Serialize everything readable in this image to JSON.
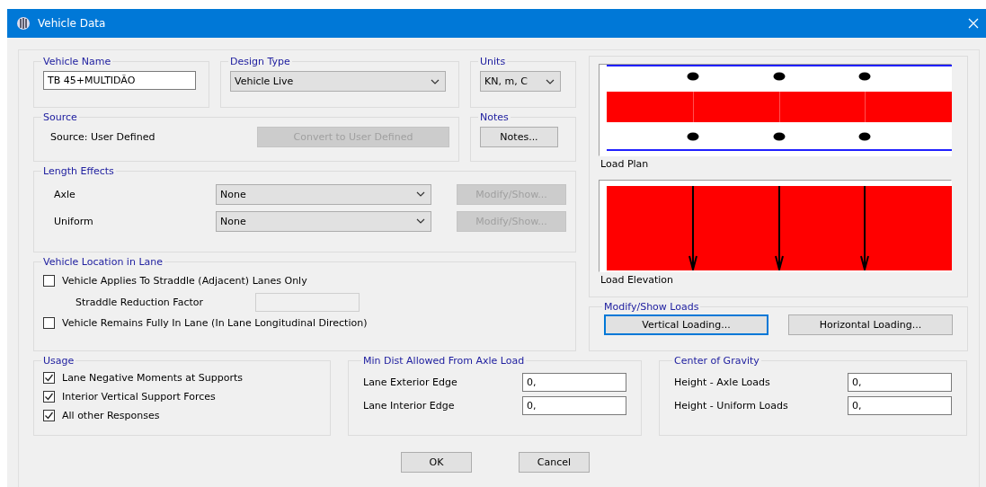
{
  "window": {
    "title": "Vehicle Data"
  },
  "vehicle_name": {
    "label": "Vehicle Name",
    "value": "TB 45+MULTIDÃO"
  },
  "design_type": {
    "label": "Design Type",
    "value": "Vehicle Live"
  },
  "units": {
    "label": "Units",
    "value": "KN, m, C"
  },
  "source": {
    "label": "Source",
    "text": "Source: User Defined",
    "button": {
      "label": "Convert to User Defined",
      "disabled": true
    }
  },
  "notes": {
    "label": "Notes",
    "button": {
      "label": "Notes...",
      "disabled": false
    }
  },
  "length_effects": {
    "label": "Length Effects",
    "rows": [
      {
        "label": "Axle",
        "value": "None",
        "button": {
          "label": "Modify/Show...",
          "disabled": true
        }
      },
      {
        "label": "Uniform",
        "value": "None",
        "button": {
          "label": "Modify/Show...",
          "disabled": true
        }
      }
    ]
  },
  "vehicle_location": {
    "label": "Vehicle Location in Lane",
    "straddle": {
      "label": "Vehicle Applies To Straddle (Adjacent) Lanes Only",
      "checked": false
    },
    "factor": {
      "label": "Straddle Reduction Factor",
      "disabled": true
    },
    "fully_in_lane": {
      "label": "Vehicle Remains Fully In Lane (In Lane Longitudinal Direction)",
      "checked": false
    }
  },
  "preview": {
    "plan_label": "Load Plan",
    "elevation_label": "Load Elevation"
  },
  "modify_loads": {
    "label": "Modify/Show Loads",
    "buttons": [
      {
        "label": "Vertical Loading...",
        "selected": true
      },
      {
        "label": "Horizontal Loading...",
        "selected": false
      }
    ]
  },
  "usage": {
    "label": "Usage",
    "items": [
      {
        "label": "Lane Negative Moments at Supports",
        "checked": true
      },
      {
        "label": "Interior Vertical Support Forces",
        "checked": true
      },
      {
        "label": "All other Responses",
        "checked": true
      }
    ]
  },
  "min_dist": {
    "label": "Min Dist Allowed From Axle Load",
    "fields": [
      {
        "label": "Lane Exterior Edge",
        "value": "0,"
      },
      {
        "label": "Lane Interior Edge",
        "value": "0,"
      }
    ]
  },
  "center_of_gravity": {
    "label": "Center of Gravity",
    "fields": [
      {
        "label": "Height - Axle Loads",
        "value": "0,"
      },
      {
        "label": "Height - Uniform Loads",
        "value": "0,"
      }
    ]
  },
  "buttons": [
    "OK",
    "Cancel"
  ]
}
